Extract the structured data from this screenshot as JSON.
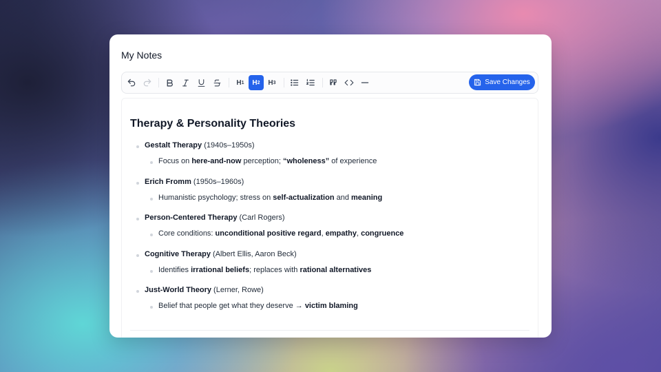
{
  "app": {
    "title": "My Notes"
  },
  "toolbar": {
    "undo_icon": "undo-icon",
    "redo_icon": "redo-icon",
    "bold_icon": "bold-icon",
    "italic_icon": "italic-icon",
    "underline_icon": "underline-icon",
    "strike_icon": "strikethrough-icon",
    "h1_label": "H",
    "h1_sub": "1",
    "h2_label": "H",
    "h2_sub": "2",
    "h3_label": "H",
    "h3_sub": "3",
    "bullet_list_icon": "bullet-list-icon",
    "ordered_list_icon": "ordered-list-icon",
    "quote_icon": "quote-icon",
    "code_icon": "code-icon",
    "hr_icon": "horizontal-rule-icon",
    "save_icon": "save-icon",
    "save_label": "Save Changes",
    "accent_color": "#2563eb"
  },
  "document": {
    "title": "Therapy & Personality Theories",
    "items": [
      {
        "heading_bold": "Gestalt Therapy",
        "heading_rest": " (1940s–1950s)",
        "detail": [
          {
            "t": "Focus on ",
            "b": false
          },
          {
            "t": "here-and-now",
            "b": true
          },
          {
            "t": " perception; ",
            "b": false
          },
          {
            "t": "“wholeness”",
            "b": true
          },
          {
            "t": " of experience",
            "b": false
          }
        ]
      },
      {
        "heading_bold": "Erich Fromm",
        "heading_rest": " (1950s–1960s)",
        "detail": [
          {
            "t": "Humanistic psychology; stress on ",
            "b": false
          },
          {
            "t": "self-actualization",
            "b": true
          },
          {
            "t": " and ",
            "b": false
          },
          {
            "t": "meaning",
            "b": true
          }
        ]
      },
      {
        "heading_bold": "Person-Centered Therapy",
        "heading_rest": " (Carl Rogers)",
        "detail": [
          {
            "t": "Core conditions: ",
            "b": false
          },
          {
            "t": "unconditional positive regard",
            "b": true
          },
          {
            "t": ", ",
            "b": false
          },
          {
            "t": "empathy",
            "b": true
          },
          {
            "t": ", ",
            "b": false
          },
          {
            "t": "congruence",
            "b": true
          }
        ]
      },
      {
        "heading_bold": "Cognitive Therapy",
        "heading_rest": " (Albert Ellis, Aaron Beck)",
        "detail": [
          {
            "t": "Identifies ",
            "b": false
          },
          {
            "t": "irrational beliefs",
            "b": true
          },
          {
            "t": "; replaces with ",
            "b": false
          },
          {
            "t": "rational alternatives",
            "b": true
          }
        ]
      },
      {
        "heading_bold": "Just-World Theory",
        "heading_rest": " (Lerner, Rowe)",
        "detail": [
          {
            "t": "Belief that people get what they deserve → ",
            "b": false
          },
          {
            "t": "victim blaming",
            "b": true
          }
        ]
      }
    ]
  }
}
